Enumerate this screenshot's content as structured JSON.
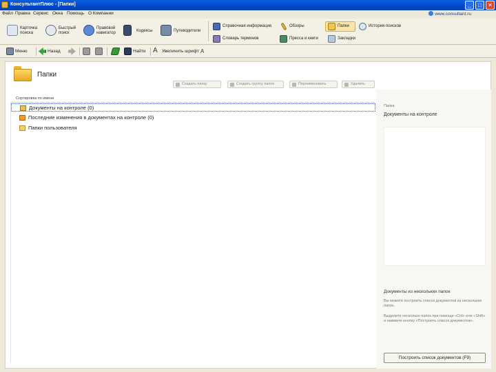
{
  "window": {
    "title": "КонсультантПлюс - [Папки]",
    "minimize": "_",
    "maximize": "□",
    "close": "✕"
  },
  "menu": {
    "items": [
      "Файл",
      "Правка",
      "Сервис",
      "Окна",
      "Помощь",
      "О Компании"
    ],
    "site_link": "www.consultant.ru"
  },
  "bigbar": {
    "buttons": [
      {
        "label": "Карточка\nпоиска",
        "icon": "search-card-icon"
      },
      {
        "label": "Быстрый\nпоиск",
        "icon": "quick-search-icon"
      },
      {
        "label": "Правовой\nнавигатор",
        "icon": "navigator-icon"
      },
      {
        "label": "Кодексы",
        "icon": "codes-icon"
      },
      {
        "label": "Путеводители",
        "icon": "guides-icon"
      }
    ],
    "right_items": [
      {
        "label": "Справочная информация",
        "icon": "reference-icon"
      },
      {
        "label": "Обзоры",
        "icon": "reviews-icon"
      },
      {
        "label": "Папки",
        "icon": "folders-icon"
      },
      {
        "label": "История поисков",
        "icon": "history-icon"
      },
      {
        "label": "Словарь терминов",
        "icon": "dictionary-icon"
      },
      {
        "label": "Пресса и книги",
        "icon": "press-icon"
      },
      {
        "label": "Закладки",
        "icon": "bookmarks-icon"
      }
    ]
  },
  "subbar": {
    "menu_label": "Меню",
    "back_label": "Назад",
    "find_label": "Найти",
    "font_label": "Увеличить шрифт"
  },
  "page": {
    "title": "Папки",
    "actions": [
      "Создать папку",
      "Создать группу папок",
      "Переименовать",
      "Удалить"
    ],
    "list_header": "Сортировка по имени",
    "rows": [
      "Документы на контроле (0)",
      "Последние изменения в документах на контроле (0)",
      "Папки пользователя"
    ]
  },
  "right_panel": {
    "small_label": "Папка",
    "folder_name": "Документы на контроле",
    "head": "Документы из нескольких папок",
    "text1": "Вы можете построить список документов из нескольких папок.",
    "text2": "Выделите несколько папок при помощи «Ctrl» или «Shift» и нажмите кнопку «Построить список документов».",
    "button": "Построить список документов (F9)"
  }
}
